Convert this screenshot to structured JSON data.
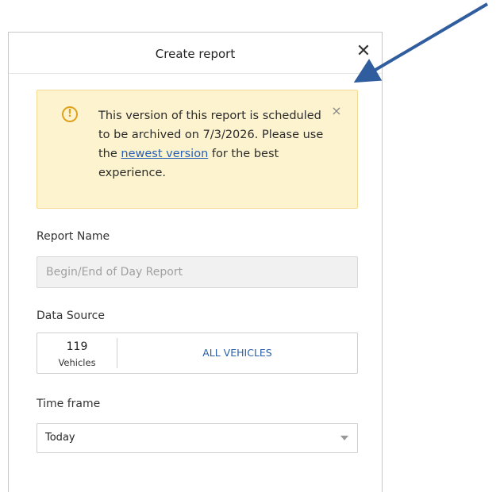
{
  "dialog": {
    "title": "Create report",
    "close_glyph": "✕"
  },
  "banner": {
    "icon": "!",
    "close_glyph": "×",
    "text_before_link": "This version of this report is scheduled to be archived on 7/3/2026. Please use the ",
    "link_text": "newest version",
    "text_after_link": " for the best experience."
  },
  "report_name": {
    "label": "Report Name",
    "placeholder": "Begin/End of Day Report"
  },
  "data_source": {
    "label": "Data Source",
    "count": "119",
    "unit": "Vehicles",
    "selection": "ALL VEHICLES"
  },
  "time_frame": {
    "label": "Time frame",
    "selected": "Today"
  },
  "arrow_color": "#2f5d9e"
}
